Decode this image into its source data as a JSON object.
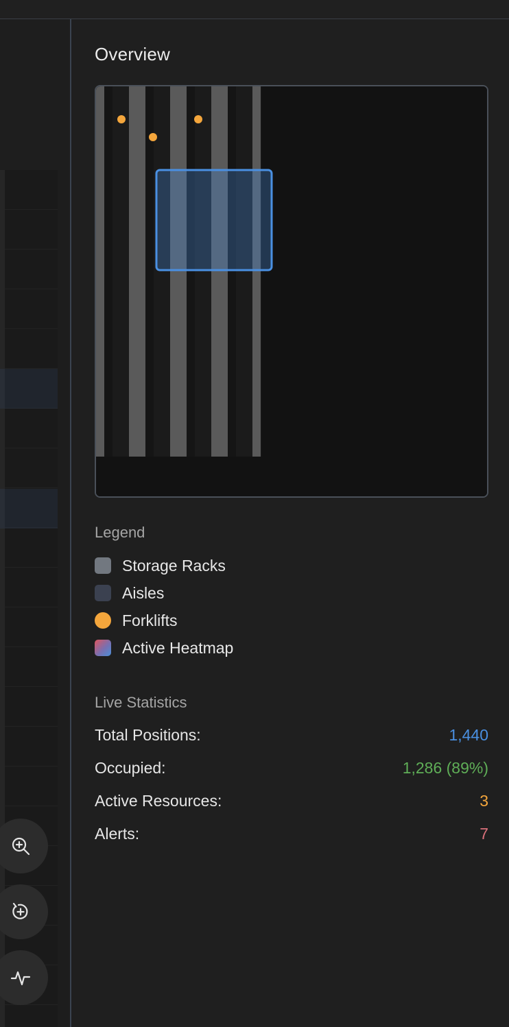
{
  "panel": {
    "title": "Overview"
  },
  "minimap": {
    "forklift_color": "#f4a63c",
    "rack_color": "#5a5a5a",
    "aisle_color": "#151515",
    "viewport_color": "#4a90e2"
  },
  "legend": {
    "title": "Legend",
    "items": [
      {
        "label": "Storage Racks",
        "color": "#727880",
        "shape": "square"
      },
      {
        "label": "Aisles",
        "color": "#3b4150",
        "shape": "square"
      },
      {
        "label": "Forklifts",
        "color": "#f4a63c",
        "shape": "circle"
      },
      {
        "label": "Active Heatmap",
        "color": "gradient",
        "shape": "square"
      }
    ]
  },
  "stats": {
    "title": "Live Statistics",
    "rows": [
      {
        "label": "Total Positions:",
        "value": "1,440",
        "color": "#4a90e2"
      },
      {
        "label": "Occupied:",
        "value": "1,286 (89%)",
        "color": "#5fae57"
      },
      {
        "label": "Active Resources:",
        "value": "3",
        "color": "#f4a63c"
      },
      {
        "label": "Alerts:",
        "value": "7",
        "color": "#d9707a"
      }
    ]
  },
  "controls": {
    "zoom_in_icon": "zoom-in-icon",
    "recenter_icon": "recenter-icon",
    "activity_icon": "activity-icon"
  }
}
